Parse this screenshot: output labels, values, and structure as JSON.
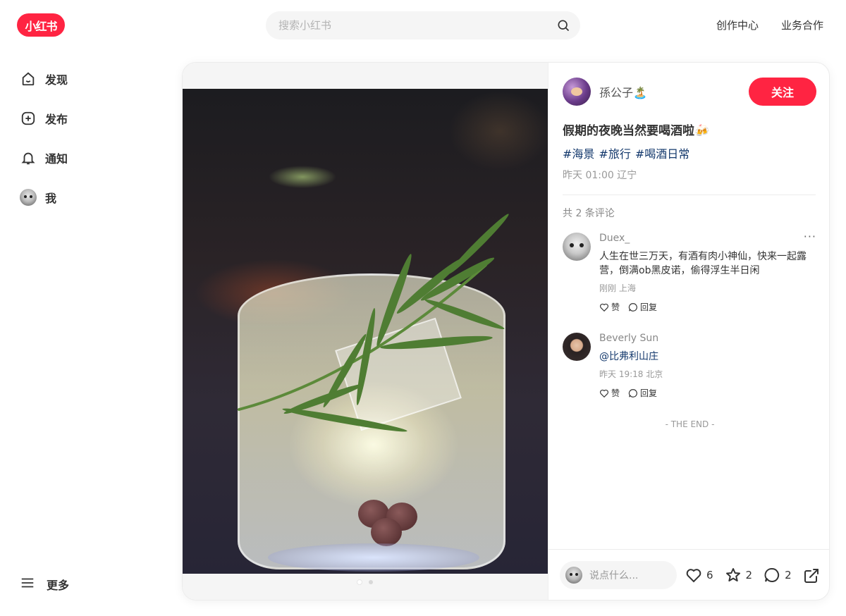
{
  "header": {
    "logo_text": "小红书",
    "search_placeholder": "搜索小红书",
    "links": [
      "创作中心",
      "业务合作"
    ]
  },
  "sidebar": {
    "items": [
      {
        "label": "发现",
        "icon": "home-icon"
      },
      {
        "label": "发布",
        "icon": "plus-square-icon"
      },
      {
        "label": "通知",
        "icon": "bell-icon"
      },
      {
        "label": "我",
        "icon": "avatar"
      }
    ],
    "more_label": "更多"
  },
  "note": {
    "image_count": 2,
    "active_image": 1,
    "author": {
      "name": "孫公子🏝️"
    },
    "follow_label": "关注",
    "title": "假期的夜晚当然要喝酒啦🍻",
    "tags": [
      "#海景",
      "#旅行",
      "#喝酒日常"
    ],
    "date_location": "昨天 01:00 辽宁",
    "comment_count_text": "共 2 条评论",
    "comments": [
      {
        "user": "Duex_",
        "text": "人生在世三万天，有酒有肉小神仙，快来一起露营，倒满ob黑皮诺，偷得浮生半日闲",
        "meta": "刚刚 上海",
        "like_label": "赞",
        "reply_label": "回复",
        "more": "···"
      },
      {
        "user": "Beverly Sun",
        "text": "@比弗利山庄",
        "meta": "昨天 19:18 北京",
        "like_label": "赞",
        "reply_label": "回复"
      }
    ],
    "end_text": "- THE END -",
    "input_placeholder": "说点什么...",
    "likes": "6",
    "collects": "2",
    "comments_total": "2"
  },
  "colors": {
    "brand": "#ff2442",
    "tag": "#13386c"
  }
}
